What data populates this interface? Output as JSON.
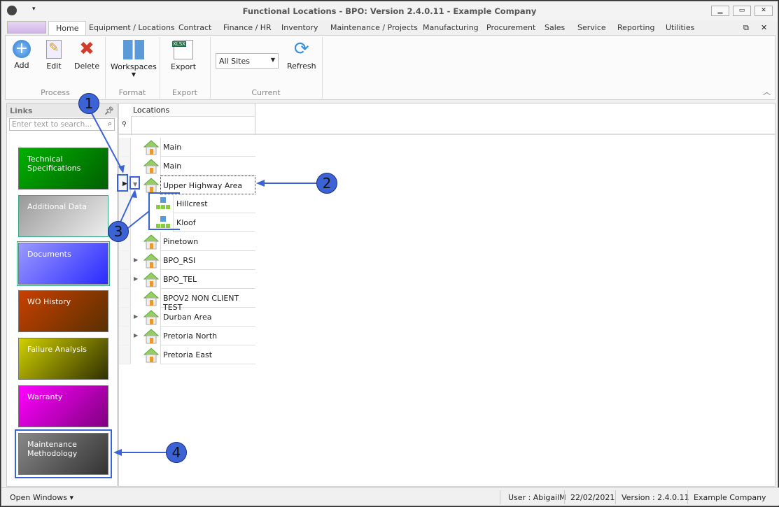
{
  "window": {
    "title": "Functional Locations - BPO: Version 2.4.0.11 - Example Company"
  },
  "tabs": [
    "Home",
    "Equipment / Locations",
    "Contract",
    "Finance / HR",
    "Inventory",
    "Maintenance / Projects",
    "Manufacturing",
    "Procurement",
    "Sales",
    "Service",
    "Reporting",
    "Utilities"
  ],
  "ribbon": {
    "add": "Add",
    "edit": "Edit",
    "delete": "Delete",
    "workspaces": "Workspaces",
    "export": "Export",
    "site": "All Sites",
    "refresh": "Refresh",
    "groups": [
      "Process",
      "Format",
      "Export",
      "Current"
    ],
    "xlsx": "XLSX"
  },
  "links": {
    "title": "Links",
    "search_placeholder": "Enter text to search...",
    "tiles": [
      {
        "label": "Technical Specifications",
        "color": "#00a000"
      },
      {
        "label": "Additional Data",
        "color": "#b0b0b0"
      },
      {
        "label": "Documents",
        "color": "#5a5aff"
      },
      {
        "label": "WO History",
        "color": "#b04000"
      },
      {
        "label": "Failure Analysis",
        "color": "#b0b000"
      },
      {
        "label": "Warranty",
        "color": "#e000e0"
      },
      {
        "label": "Maintenance Methodology",
        "color": "#606060"
      }
    ]
  },
  "grid": {
    "column": "Locations",
    "rows": [
      {
        "label": "Main",
        "type": "site"
      },
      {
        "label": "Main",
        "type": "site"
      },
      {
        "label": "Upper Highway Area",
        "type": "site",
        "expanded": true
      },
      {
        "label": "Hillcrest",
        "type": "child"
      },
      {
        "label": "Kloof",
        "type": "child"
      },
      {
        "label": "Pinetown",
        "type": "site"
      },
      {
        "label": "BPO_RSI",
        "type": "site",
        "expandable": true
      },
      {
        "label": "BPO_TEL",
        "type": "site",
        "expandable": true
      },
      {
        "label": "BPOV2 NON CLIENT TEST",
        "type": "site"
      },
      {
        "label": "Durban Area",
        "type": "site",
        "expandable": true
      },
      {
        "label": "Pretoria North",
        "type": "site",
        "expandable": true
      },
      {
        "label": "Pretoria East",
        "type": "site"
      }
    ]
  },
  "callouts": [
    "1",
    "2",
    "3",
    "4"
  ],
  "status": {
    "open_windows": "Open Windows",
    "user": "User : AbigailM",
    "date": "22/02/2021",
    "version": "Version : 2.4.0.11",
    "company": "Example Company"
  }
}
